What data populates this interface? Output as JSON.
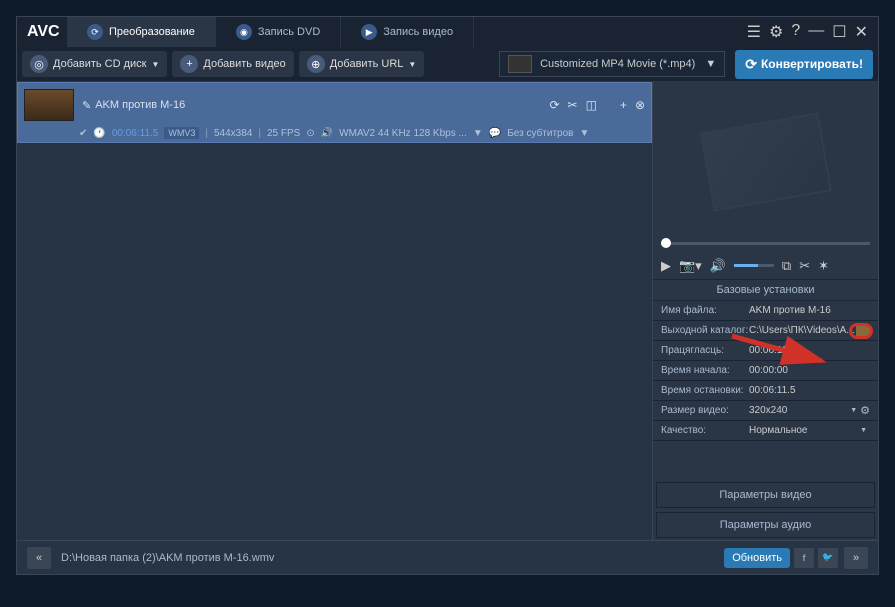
{
  "logo": "AVC",
  "tabs": {
    "convert": "Преобразование",
    "dvd": "Запись DVD",
    "video": "Запись видео"
  },
  "toolbar": {
    "add_cd": "Добавить CD диск",
    "add_video": "Добавить видео",
    "add_url": "Добавить URL"
  },
  "format": {
    "selected": "Customized MP4 Movie (*.mp4)"
  },
  "convert_btn": "Конвертировать!",
  "file": {
    "name": "AKM против M-16",
    "duration": "00:06:11.5",
    "codec": "WMV3",
    "resolution": "544x384",
    "fps": "25 FPS",
    "audio": "WMAV2 44 KHz 128 Kbps ...",
    "subtitle": "Без субтитров"
  },
  "settings": {
    "header": "Базовые установки",
    "filename_label": "Имя файла:",
    "filename_value": "AKM против M-16",
    "outdir_label": "Выходной каталог:",
    "outdir_value": "C:\\Users\\ПК\\Videos\\A...",
    "duration_label": "Працягласць:",
    "duration_value": "00:06:11.5",
    "start_label": "Время начала:",
    "start_value": "00:00:00",
    "stop_label": "Время остановки:",
    "stop_value": "00:06:11.5",
    "size_label": "Размер видео:",
    "size_value": "320x240",
    "quality_label": "Качество:",
    "quality_value": "Нормальное"
  },
  "params": {
    "video": "Параметры видео",
    "audio": "Параметры аудио"
  },
  "statusbar": {
    "path": "D:\\Новая папка (2)\\AKM против М-16.wmv",
    "update": "Обновить"
  }
}
